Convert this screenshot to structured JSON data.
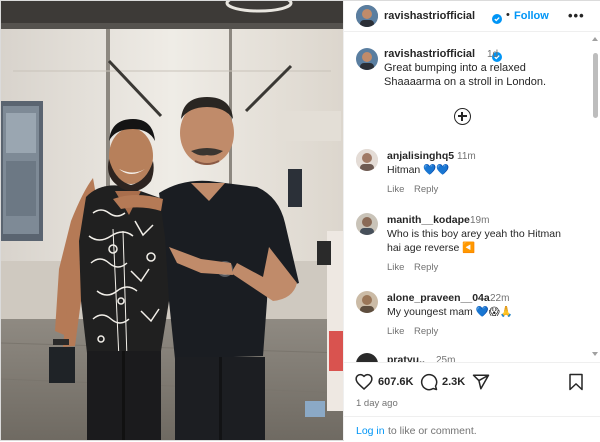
{
  "post": {
    "username": "ravishastriofficial",
    "follow_label": "Follow",
    "separator": "•",
    "more_label": "•••",
    "caption_time": "1d",
    "caption_line1": "Great bumping into a relaxed",
    "caption_line2": "Shaaaarma on a stroll in London."
  },
  "comments": [
    {
      "username": "anjalisinghq5",
      "time": "11m",
      "text": "Hitman 💙💙",
      "like": "Like",
      "reply": "Reply"
    },
    {
      "username": "manith__kodape",
      "time": "19m",
      "text_line1": "Who is this boy arey yeah tho Hitman",
      "text_line2": "hai age reverse ◀️",
      "like": "Like",
      "reply": "Reply"
    },
    {
      "username": "alone_praveen__04a",
      "time": "22m",
      "text": "My youngest mam 💙😱🙏",
      "like": "Like",
      "reply": "Reply"
    },
    {
      "username": "pratyu..",
      "time": "25m"
    }
  ],
  "footer": {
    "likes": "607.6K",
    "comments_count": "2.3K",
    "posted_ago": "1 day ago",
    "login_link": "Log in",
    "login_rest": "to like or comment."
  },
  "icons": [
    "heart-icon",
    "comment-icon",
    "share-icon",
    "bookmark-icon",
    "add-comment-icon",
    "verified-icon",
    "more-icon"
  ],
  "colors": {
    "link": "#0095f6",
    "verified": "#0095f6",
    "text": "#262626",
    "muted": "#737373"
  }
}
